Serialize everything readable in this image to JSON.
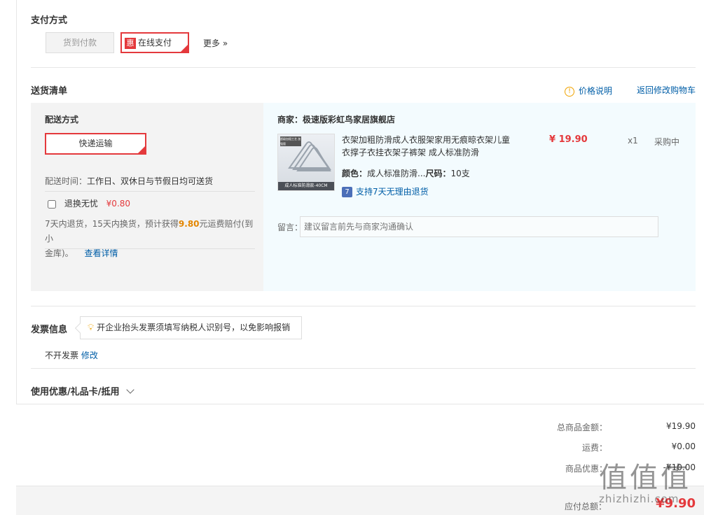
{
  "payment": {
    "title": "支付方式",
    "cod_label": "货到付款",
    "hui_badge": "惠",
    "online_label": "在线支付",
    "more_label": "更多 »"
  },
  "delivery": {
    "title": "送货清单",
    "price_note_label": "价格说明",
    "back_to_cart_label": "返回修改购物车",
    "method_title": "配送方式",
    "method_value": "快递运输",
    "time_label": "配送时间：",
    "time_value": "工作日、双休日与节假日均可送货",
    "worry_free_label": "退换无忧",
    "worry_free_price": "¥0.80",
    "worry_desc_1": "7天内退货，15天内换货，预计获得",
    "worry_desc_amount": "9.80",
    "worry_desc_2": "元运费赔付(到小",
    "worry_desc_3": "金库)。",
    "details_link": "查看详情"
  },
  "merchant": {
    "label": "商家：",
    "name": "极速版彩虹鸟家居旗舰店"
  },
  "product": {
    "title_line1": "衣架加粗防滑成人衣服架家用无痕晾衣架儿童",
    "title_line2": "衣撑子衣挂衣架子裤架 成人标准防滑",
    "price": "¥ 19.90",
    "qty": "x1",
    "status": "采购中",
    "color_label": "颜色：",
    "color_value": "成人标准防滑...",
    "size_label": "尺码：",
    "size_value": "10支",
    "return_icon": "7",
    "return_text": "支持7天无理由退货",
    "thumb_bar": "成人标准防滑款-40CM",
    "thumb_tag": "超级加粗工艺 加强版"
  },
  "memo": {
    "label": "留言：",
    "placeholder": "建议留言前先与商家沟通确认"
  },
  "invoice": {
    "title": "发票信息",
    "tip": "开企业抬头发票须填写纳税人识别号，以免影响报销",
    "value": "不开发票",
    "edit_label": "修改"
  },
  "coupon": {
    "title": "使用优惠/礼品卡/抵用"
  },
  "summary": {
    "goods_total_label": "总商品金额：",
    "goods_total_value": "¥19.90",
    "shipping_label": "运费：",
    "shipping_value": "¥0.00",
    "discount_label": "商品优惠：",
    "discount_value": "-¥10.00",
    "payable_label": "应付总额：",
    "payable_value": "¥9.90"
  },
  "watermark": {
    "glyph": "值值值",
    "text": "zhizhizhi.com"
  },
  "colors": {
    "accent_red": "#e4393c",
    "link_blue": "#005ea7",
    "panel_left": "#f3f3f3",
    "panel_right": "#f3fbfe"
  }
}
